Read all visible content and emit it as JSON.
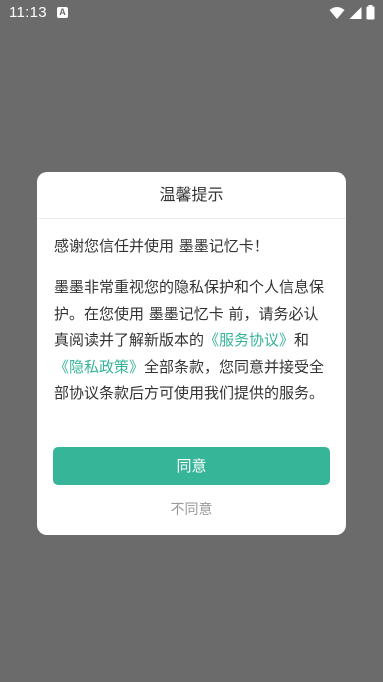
{
  "status_bar": {
    "time": "11:13",
    "notification_icon_glyph": "A",
    "icons": [
      "wifi-icon",
      "signal-icon",
      "battery-icon"
    ]
  },
  "dialog": {
    "title": "温馨提示",
    "greeting": "感谢您信任并使用 墨墨记忆卡！",
    "body": {
      "part1": "墨墨非常重视您的隐私保护和个人信息保护。在您使用 墨墨记忆卡 前，请务必认真阅读并了解新版本的",
      "service_agreement_link": "《服务协议》",
      "and": "和",
      "privacy_policy_link": "《隐私政策》",
      "part2": "全部条款，您同意并接受全部协议条款后方可使用我们提供的服务。"
    },
    "agree_label": "同意",
    "disagree_label": "不同意"
  },
  "colors": {
    "accent": "#37b599",
    "link": "#35b49a",
    "overlay": "#6b6b6b"
  }
}
